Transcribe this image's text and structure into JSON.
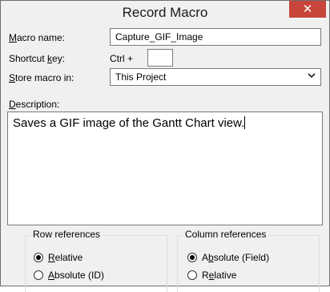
{
  "dialog": {
    "title": "Record Macro",
    "close_glyph": "✕"
  },
  "macro_name": {
    "label_mnemonic": "M",
    "label_rest": "acro name:",
    "value": "Capture_GIF_Image"
  },
  "shortcut_key": {
    "label_pre": "Shortcut ",
    "label_mnemonic": "k",
    "label_post": "ey:",
    "prefix": "Ctrl +",
    "value": ""
  },
  "store_macro": {
    "label_mnemonic": "S",
    "label_rest": "tore macro in:",
    "selected": "This Project",
    "arrow_icon": "chevron-down-icon"
  },
  "description": {
    "label_mnemonic": "D",
    "label_rest": "escription:",
    "value": "Saves a GIF image of the Gantt Chart view."
  },
  "row_references": {
    "title": "Row references",
    "options": [
      {
        "mnemonic": "R",
        "rest": "elative",
        "checked": true
      },
      {
        "mnemonic": "A",
        "rest": "bsolute (ID)",
        "checked": false
      }
    ]
  },
  "column_references": {
    "title": "Column references",
    "options": [
      {
        "pre": "A",
        "mnemonic": "b",
        "rest": "solute (Field)",
        "checked": true
      },
      {
        "pre": "R",
        "mnemonic": "e",
        "rest": "lative",
        "checked": false
      }
    ]
  }
}
